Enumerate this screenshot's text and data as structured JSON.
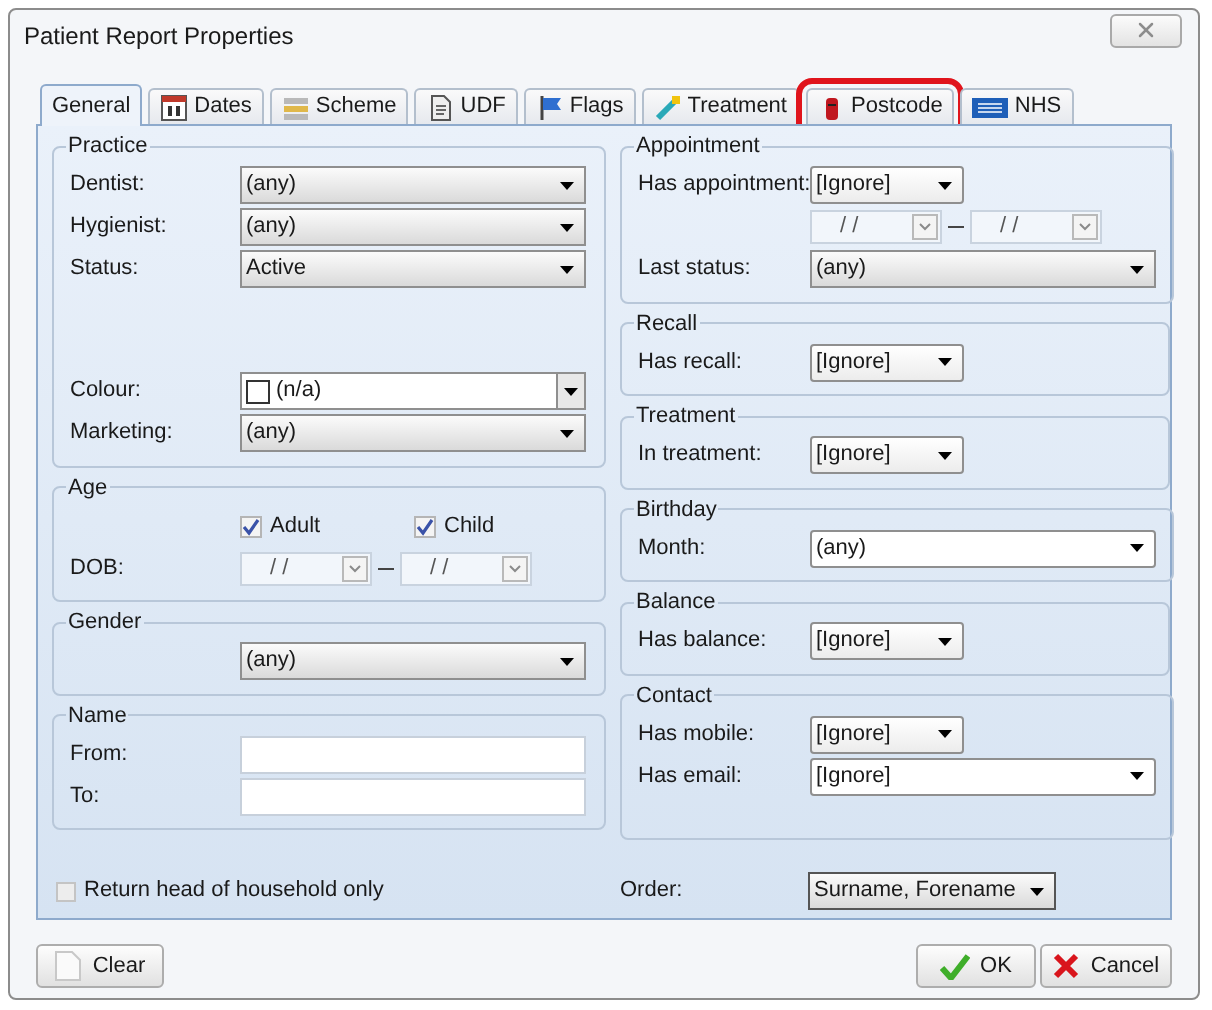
{
  "window": {
    "title": "Patient Report Properties"
  },
  "tabs": [
    {
      "label": "General",
      "selected": true,
      "highlighted": false
    },
    {
      "label": "Dates",
      "selected": false,
      "highlighted": false
    },
    {
      "label": "Scheme",
      "selected": false,
      "highlighted": false
    },
    {
      "label": "UDF",
      "selected": false,
      "highlighted": false
    },
    {
      "label": "Flags",
      "selected": false,
      "highlighted": false
    },
    {
      "label": "Treatment",
      "selected": false,
      "highlighted": false
    },
    {
      "label": "Postcode",
      "selected": false,
      "highlighted": true
    },
    {
      "label": "NHS",
      "selected": false,
      "highlighted": false
    }
  ],
  "left_groups": [
    {
      "title": "Practice",
      "rows": [
        {
          "kind": "dropdown",
          "label": "Dentist:",
          "value": "(any)"
        },
        {
          "kind": "dropdown",
          "label": "Hygienist:",
          "value": "(any)"
        },
        {
          "kind": "dropdown",
          "label": "Status:",
          "value": "Active"
        },
        {
          "kind": "colour",
          "label": "Colour:",
          "value": "(n/a)"
        },
        {
          "kind": "dropdown",
          "label": "Marketing:",
          "value": "(any)"
        }
      ]
    },
    {
      "title": "Age",
      "rows": [
        {
          "kind": "checkboxes",
          "items": [
            {
              "label": "Adult",
              "checked": true
            },
            {
              "label": "Child",
              "checked": true
            }
          ]
        },
        {
          "kind": "date_range",
          "label": "DOB:",
          "from": "/ /",
          "to": "/ /"
        }
      ]
    },
    {
      "title": "Gender",
      "rows": [
        {
          "kind": "dropdown",
          "value": "(any)"
        }
      ]
    },
    {
      "title": "Name",
      "rows": [
        {
          "kind": "text",
          "label": "From:"
        },
        {
          "kind": "text",
          "label": "To:"
        }
      ]
    }
  ],
  "right_groups": [
    {
      "title": "Appointment",
      "rows": [
        {
          "kind": "short_dropdown",
          "label": "Has appointment:",
          "value": "[Ignore]"
        },
        {
          "kind": "date_range",
          "from": "/ /",
          "to": "/ /"
        },
        {
          "kind": "dropdown",
          "label": "Last status:",
          "value": "(any)"
        }
      ]
    },
    {
      "title": "Recall",
      "rows": [
        {
          "kind": "short_dropdown",
          "label": "Has recall:",
          "value": "[Ignore]"
        }
      ]
    },
    {
      "title": "Treatment",
      "rows": [
        {
          "kind": "short_dropdown",
          "label": "In treatment:",
          "value": "[Ignore]"
        }
      ]
    },
    {
      "title": "Birthday",
      "rows": [
        {
          "kind": "combo",
          "label": "Month:",
          "value": "(any)"
        }
      ]
    },
    {
      "title": "Balance",
      "rows": [
        {
          "kind": "short_dropdown",
          "label": "Has balance:",
          "value": "[Ignore]"
        }
      ]
    },
    {
      "title": "Contact",
      "rows": [
        {
          "kind": "short_dropdown",
          "label": "Has mobile:",
          "value": "[Ignore]"
        },
        {
          "kind": "combo",
          "label": "Has email:",
          "value": "[Ignore]"
        }
      ]
    }
  ],
  "head_of_household": {
    "label": "Return head of household only",
    "checked": false
  },
  "order": {
    "label": "Order:",
    "value": "Surname, Forename"
  },
  "buttons": [
    {
      "kind": "clear",
      "label": "Clear"
    },
    {
      "kind": "ok",
      "label": "OK"
    },
    {
      "kind": "cancel",
      "label": "Cancel"
    }
  ]
}
